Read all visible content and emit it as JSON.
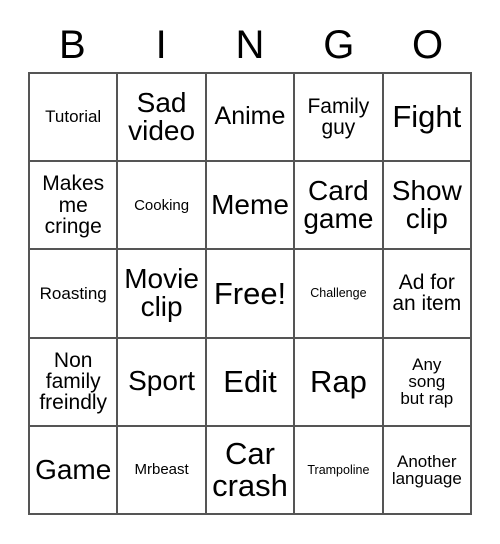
{
  "card": {
    "title": "BINGO",
    "header_letters": [
      "B",
      "I",
      "N",
      "G",
      "O"
    ],
    "colors": {
      "border": "#555555",
      "text": "#000000",
      "background": "#ffffff"
    },
    "grid_size": "5x5",
    "free_space_index": 12,
    "cells": [
      {
        "text": "Tutorial",
        "size": "sm"
      },
      {
        "text": "Sad\nvideo",
        "size": "xl"
      },
      {
        "text": "Anime",
        "size": "lg"
      },
      {
        "text": "Family\nguy",
        "size": "md"
      },
      {
        "text": "Fight",
        "size": "xxl"
      },
      {
        "text": "Makes\nme\ncringe",
        "size": "md"
      },
      {
        "text": "Cooking",
        "size": "xs"
      },
      {
        "text": "Meme",
        "size": "xl"
      },
      {
        "text": "Card\ngame",
        "size": "xl"
      },
      {
        "text": "Show\nclip",
        "size": "xl"
      },
      {
        "text": "Roasting",
        "size": "sm"
      },
      {
        "text": "Movie\nclip",
        "size": "xl"
      },
      {
        "text": "Free!",
        "size": "xxl"
      },
      {
        "text": "Challenge",
        "size": "xxs"
      },
      {
        "text": "Ad for\nan item",
        "size": "md"
      },
      {
        "text": "Non\nfamily\nfreindly",
        "size": "md"
      },
      {
        "text": "Sport",
        "size": "xl"
      },
      {
        "text": "Edit",
        "size": "xxl"
      },
      {
        "text": "Rap",
        "size": "xxl"
      },
      {
        "text": "Any\nsong\nbut rap",
        "size": "sm"
      },
      {
        "text": "Game",
        "size": "xl"
      },
      {
        "text": "Mrbeast",
        "size": "xs"
      },
      {
        "text": "Car\ncrash",
        "size": "xxl"
      },
      {
        "text": "Trampoline",
        "size": "xxs"
      },
      {
        "text": "Another\nlanguage",
        "size": "sm"
      }
    ]
  }
}
